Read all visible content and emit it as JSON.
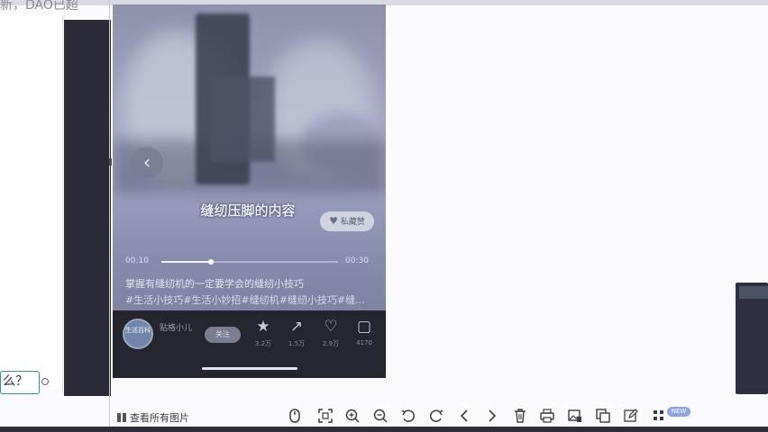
{
  "background": {
    "title_fragment": "新，DAO已超",
    "question_text": "么？"
  },
  "video": {
    "back_icon": "chevron-left-icon",
    "caption": "缝纫压脚的内容",
    "like_label": "私藏赞",
    "time_current": "00:10",
    "time_total": "00:30",
    "progress": 0.28,
    "description": "掌握有缝纫机的一定要学会的缝纫小技巧",
    "tags": "#生活小技巧#生活小妙招#缝纫机#缝纫小技巧#缝..."
  },
  "user": {
    "avatar_text": "生活百科",
    "name": "贴格小儿",
    "sub": "",
    "follow_label": "关注"
  },
  "actions": [
    {
      "name": "star",
      "icon": "★",
      "count": "3.2万"
    },
    {
      "name": "share",
      "icon": "↗",
      "count": "1.5万"
    },
    {
      "name": "like",
      "icon": "♡",
      "count": "2.9万"
    },
    {
      "name": "comment",
      "icon": "▢",
      "count": "4170"
    }
  ],
  "toolbar": {
    "all_images_label": "查看所有图片",
    "new_badge": "NEW"
  },
  "colors": {
    "bottom_bar": "#25252f",
    "accent": "#8fa5df"
  }
}
